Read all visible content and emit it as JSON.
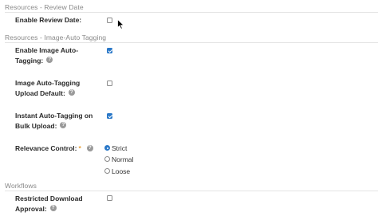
{
  "sections": {
    "review_date": {
      "title": "Resources - Review Date"
    },
    "auto_tagging": {
      "title": "Resources - Image-Auto Tagging"
    },
    "workflows": {
      "title": "Workflows"
    }
  },
  "fields": {
    "enable_review_date": {
      "label": "Enable Review Date:",
      "checked": false
    },
    "enable_auto_tagging": {
      "label_line1": "Enable Image Auto-",
      "label_line2": "Tagging:",
      "checked": true
    },
    "auto_tagging_upload_default": {
      "label_line1": "Image Auto-Tagging",
      "label_line2": "Upload Default:",
      "checked": false
    },
    "instant_auto_tagging": {
      "label_line1": "Instant Auto-Tagging on",
      "label_line2": "Bulk Upload:",
      "checked": true
    },
    "relevance_control": {
      "label": "Relevance Control:",
      "required_mark": "*",
      "options": [
        "Strict",
        "Normal",
        "Loose"
      ],
      "selected": "Strict"
    },
    "restricted_download_approval": {
      "label_line1": "Restricted Download",
      "label_line2": "Approval:",
      "checked": false
    }
  },
  "icons": {
    "help": "help-circle-icon",
    "cursor": "mouse-pointer-icon"
  },
  "colors": {
    "accent": "#2a78c8",
    "required": "#e8a03a",
    "section_text": "#888888"
  }
}
